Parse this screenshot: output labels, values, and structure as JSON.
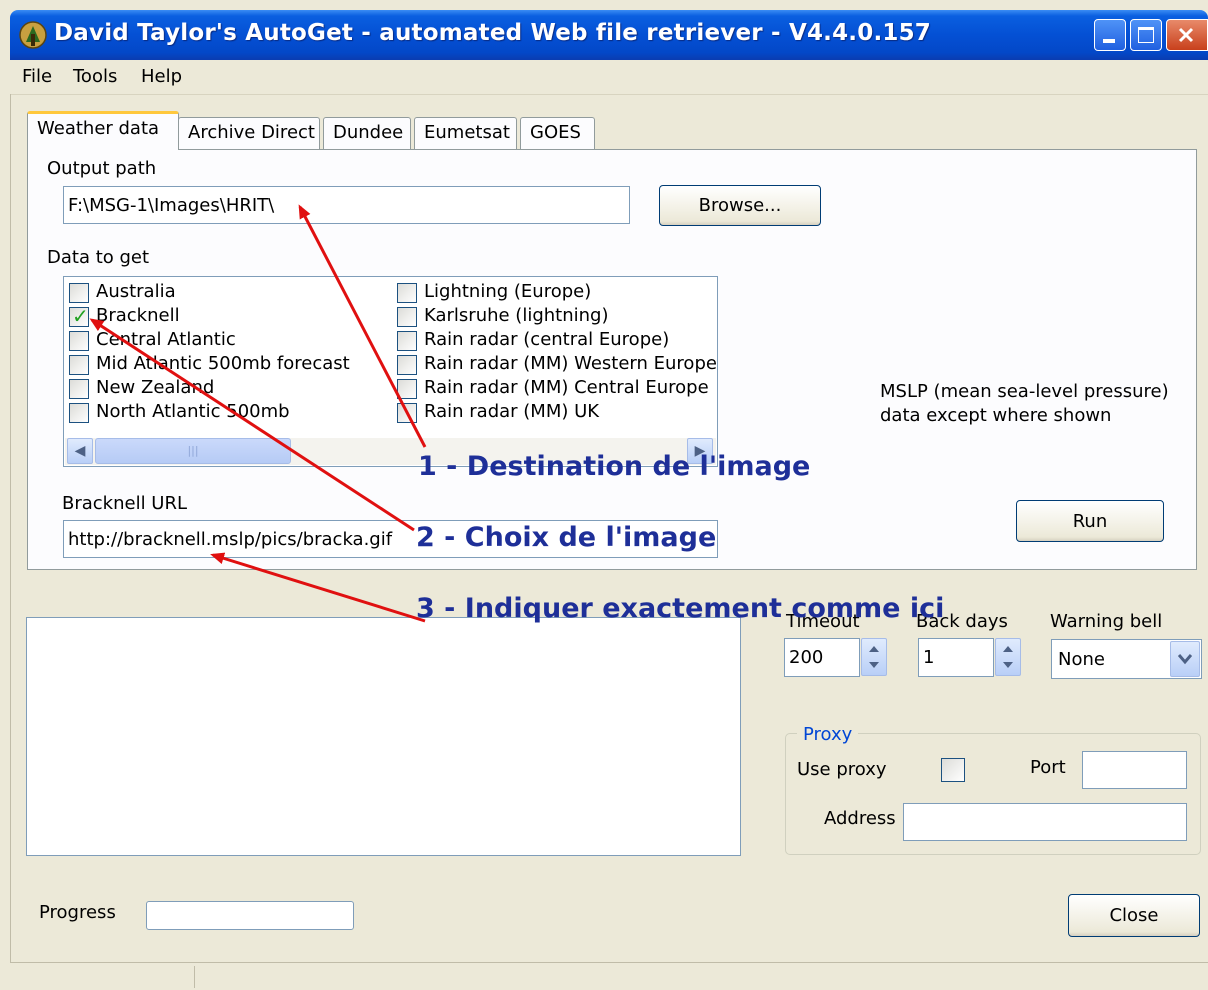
{
  "window": {
    "title": "David Taylor's AutoGet - automated Web file retriever - V4.4.0.157"
  },
  "menu": [
    "File",
    "Tools",
    "Help"
  ],
  "tabs": [
    {
      "label": "Weather data",
      "active": true
    },
    {
      "label": "Archive Direct",
      "active": false
    },
    {
      "label": "Dundee",
      "active": false
    },
    {
      "label": "Eumetsat",
      "active": false
    },
    {
      "label": "GOES",
      "active": false
    }
  ],
  "output_path": {
    "label": "Output path",
    "value": "F:\\MSG-1\\Images\\HRIT\\",
    "browse_label": "Browse..."
  },
  "data_to_get": {
    "label": "Data to get",
    "left_items": [
      {
        "label": "Australia",
        "checked": false
      },
      {
        "label": "Bracknell",
        "checked": true
      },
      {
        "label": "Central Atlantic",
        "checked": false
      },
      {
        "label": "Mid Atlantic 500mb forecast",
        "checked": false
      },
      {
        "label": "New Zealand",
        "checked": false
      },
      {
        "label": "North Atlantic 500mb",
        "checked": false
      }
    ],
    "right_items": [
      {
        "label": "Lightning (Europe)",
        "checked": false
      },
      {
        "label": "Karlsruhe (lightning)",
        "checked": false
      },
      {
        "label": "Rain radar (central Europe)",
        "checked": false
      },
      {
        "label": "Rain radar (MM) Western Europe",
        "checked": false
      },
      {
        "label": "Rain radar (MM) Central Europe",
        "checked": false
      },
      {
        "label": "Rain radar (MM) UK",
        "checked": false
      }
    ]
  },
  "note": {
    "line1": "MSLP (mean sea-level pressure)",
    "line2": "data except where shown"
  },
  "url": {
    "label": "Bracknell URL",
    "value": "http://bracknell.mslp/pics/bracka.gif"
  },
  "run_label": "Run",
  "timeout": {
    "label": "Timeout",
    "value": "200"
  },
  "back_days": {
    "label": "Back days",
    "value": "1"
  },
  "warning_bell": {
    "label": "Warning bell",
    "value": "None"
  },
  "proxy": {
    "legend": "Proxy",
    "use_label": "Use proxy",
    "port_label": "Port",
    "address_label": "Address"
  },
  "progress_label": "Progress",
  "close_label": "Close",
  "annotations": {
    "a1": "1 - Destination de l'image",
    "a2": "2 - Choix de l'image",
    "a3": "3 - Indiquer exactement comme ici"
  },
  "colors": {
    "title_blue": "#0450d4",
    "annotation_blue": "#1e2f98",
    "arrow_red": "#e01010",
    "check_green": "#21a121",
    "active_tab_accent": "#ffc83c"
  }
}
